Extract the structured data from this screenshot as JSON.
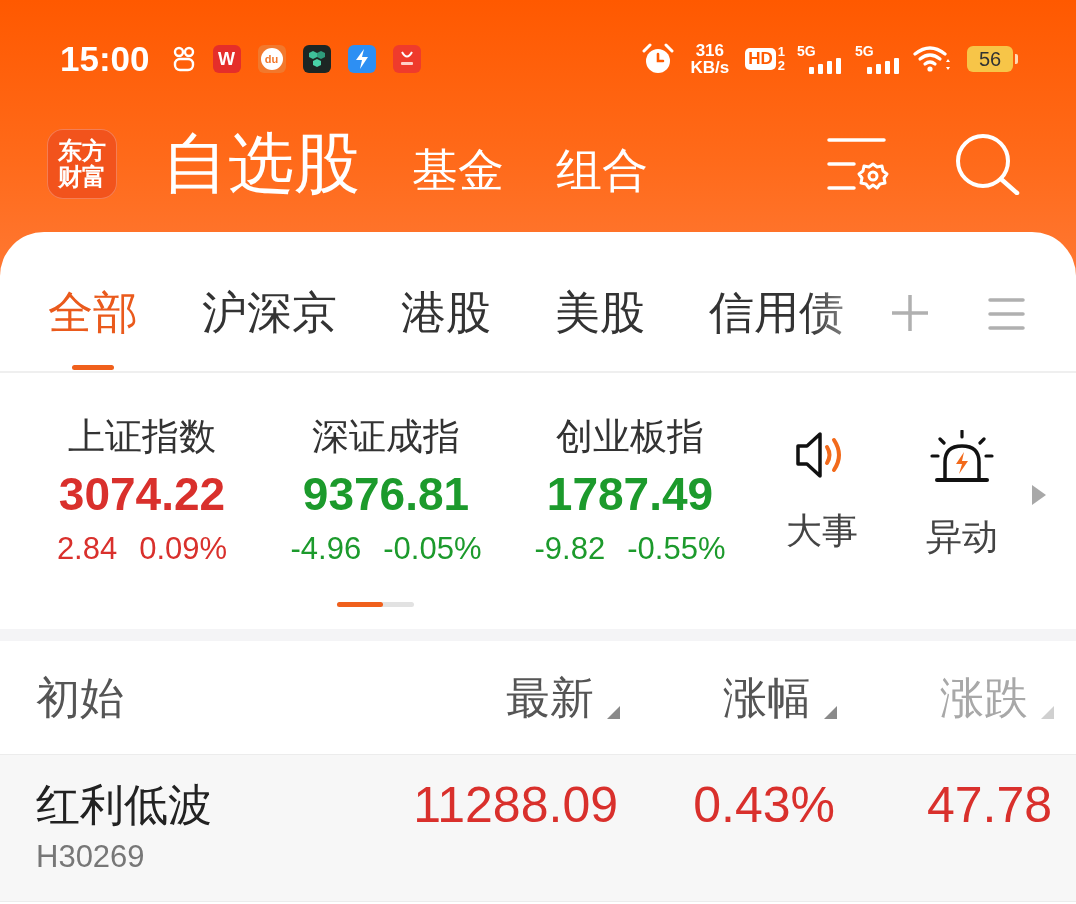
{
  "status_bar": {
    "time": "15:00",
    "app_icons": [
      {
        "kind": "circles"
      },
      {
        "kind": "letter",
        "label": "W",
        "color": "#e52e2a"
      },
      {
        "kind": "ring",
        "label": "du",
        "color": "#f2782c"
      },
      {
        "kind": "hexagons",
        "color": "#1d2624"
      },
      {
        "kind": "bolt",
        "color": "#2d8ff3"
      },
      {
        "kind": "emblem",
        "color": "#ef3b2c"
      }
    ],
    "network_speed": {
      "value": "316",
      "unit": "KB/s"
    },
    "hd_badge": "HD",
    "sim_slots": [
      "1",
      "2"
    ],
    "signals": [
      {
        "label": "5G"
      },
      {
        "label": "5G"
      }
    ],
    "battery": "56"
  },
  "header": {
    "logo": "东方财富",
    "tabs": [
      {
        "label": "自选股",
        "selected": true
      },
      {
        "label": "基金",
        "selected": false
      },
      {
        "label": "组合",
        "selected": false
      }
    ]
  },
  "market_tabs": [
    {
      "label": "全部",
      "selected": true
    },
    {
      "label": "沪深京",
      "selected": false
    },
    {
      "label": "港股",
      "selected": false
    },
    {
      "label": "美股",
      "selected": false
    },
    {
      "label": "信用债",
      "selected": false
    }
  ],
  "indices": [
    {
      "name": "上证指数",
      "value": "3074.22",
      "change": "2.84",
      "percent": "0.09%",
      "color": "#d9302c"
    },
    {
      "name": "深证成指",
      "value": "9376.81",
      "change": "-4.96",
      "percent": "-0.05%",
      "color": "#1c9a2c"
    },
    {
      "name": "创业板指",
      "value": "1787.49",
      "change": "-9.82",
      "percent": "-0.55%",
      "color": "#1c9a2c"
    }
  ],
  "shortcuts": [
    {
      "kind": "speaker",
      "label": "大事"
    },
    {
      "kind": "siren",
      "label": "异动"
    }
  ],
  "watchlist": {
    "group": "初始",
    "columns": [
      {
        "label": "最新",
        "faded": false
      },
      {
        "label": "涨幅",
        "faded": false
      },
      {
        "label": "涨跌",
        "faded": true
      }
    ],
    "rows": [
      {
        "name": "红利低波",
        "code": "H30269",
        "price": "11288.09",
        "percent": "0.43%",
        "change": "47.78",
        "color": "#d9302c"
      }
    ]
  }
}
